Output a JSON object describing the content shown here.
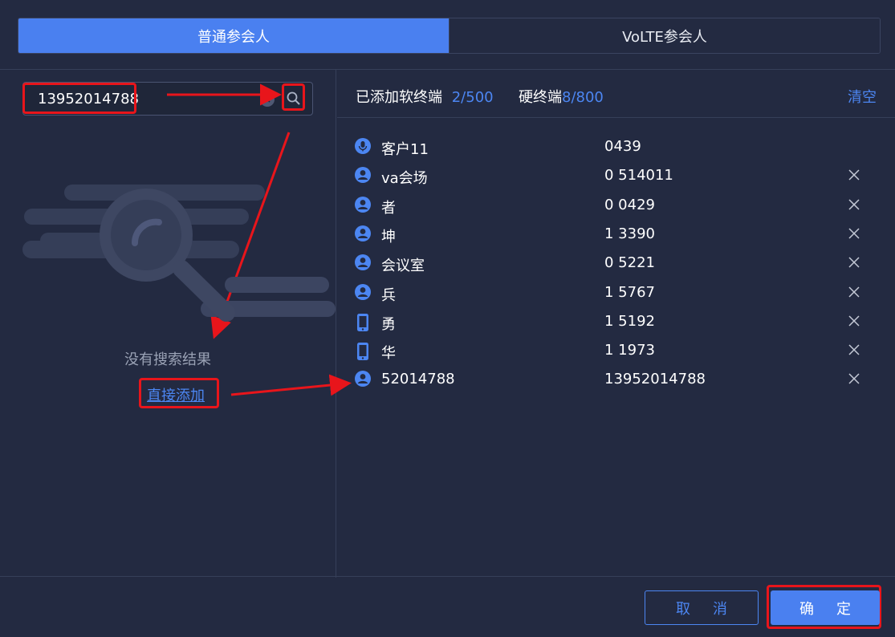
{
  "tabs": [
    {
      "label": "普通参会人",
      "active": true
    },
    {
      "label": "VoLTE参会人",
      "active": false
    }
  ],
  "search": {
    "value": "13952014788"
  },
  "empty": {
    "message": "没有搜索结果",
    "add_link": "直接添加"
  },
  "summary": {
    "soft_label": "已添加软终端",
    "soft_count": "2/500",
    "hard_label": "硬终端",
    "hard_count": "8/800",
    "clear_label": "清空"
  },
  "participants": [
    {
      "name": "客户11",
      "number": "0439",
      "icon": "microphone-icon",
      "removable": false
    },
    {
      "name": "va会场",
      "number": "0 514011",
      "icon": "user-icon",
      "removable": true
    },
    {
      "name": "者",
      "number": "0 0429",
      "icon": "user-icon",
      "removable": true
    },
    {
      "name": "坤",
      "number": "1 3390",
      "icon": "user-icon",
      "removable": true
    },
    {
      "name": "会议室",
      "number": "0 5221",
      "icon": "user-icon",
      "removable": true
    },
    {
      "name": "兵",
      "number": "1 5767",
      "icon": "user-icon",
      "removable": true
    },
    {
      "name": "勇",
      "number": "1 5192",
      "icon": "phone-icon",
      "removable": true
    },
    {
      "name": "华",
      "number": "1 1973",
      "icon": "phone-icon",
      "removable": true
    },
    {
      "name": "52014788",
      "number": "13952014788",
      "icon": "user-icon",
      "removable": true
    }
  ],
  "buttons": {
    "cancel": "取消",
    "ok": "确定"
  },
  "colors": {
    "accent": "#4a80f0",
    "background": "#232a41",
    "highlight": "#e8151b"
  }
}
